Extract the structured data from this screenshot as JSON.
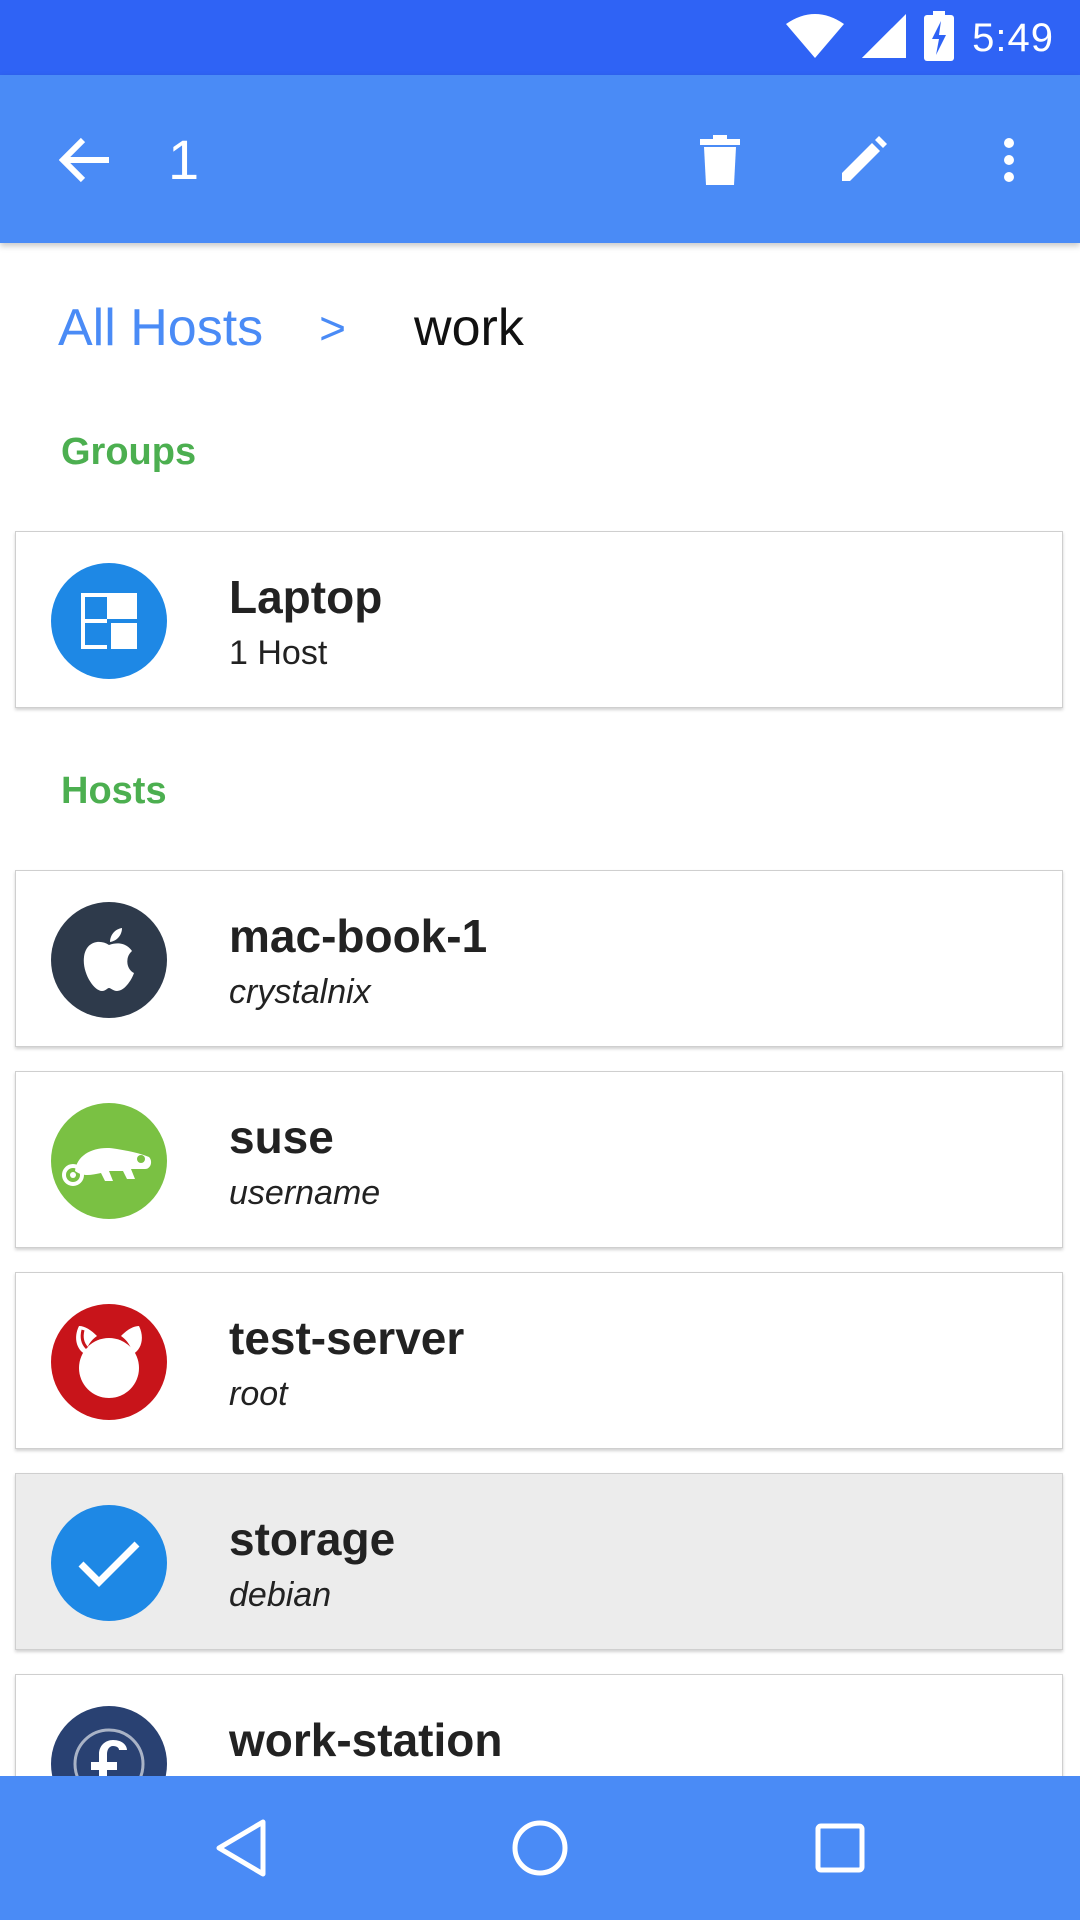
{
  "status_bar": {
    "time": "5:49",
    "icons": [
      "wifi-icon",
      "signal-icon",
      "battery-charging-icon"
    ]
  },
  "toolbar": {
    "selected_count": "1",
    "icons": [
      "back-arrow-icon",
      "delete-icon",
      "edit-icon",
      "more-vert-icon"
    ]
  },
  "breadcrumb": {
    "root": "All Hosts",
    "separator": ">",
    "current": "work"
  },
  "sections": {
    "groups_label": "Groups",
    "hosts_label": "Hosts"
  },
  "groups": [
    {
      "name": "Laptop",
      "subtitle": "1 Host",
      "icon": "group-icon",
      "color": "#1E88E5"
    }
  ],
  "hosts": [
    {
      "name": "mac-book-1",
      "user": "crystalnix",
      "icon": "apple-icon",
      "color": "#2E3A4B",
      "selected": false
    },
    {
      "name": "suse",
      "user": "username",
      "icon": "suse-icon",
      "color": "#7AC143",
      "selected": false
    },
    {
      "name": "test-server",
      "user": "root",
      "icon": "freebsd-icon",
      "color": "#C8141A",
      "selected": false
    },
    {
      "name": "storage",
      "user": "debian",
      "icon": "check-icon",
      "color": "#1E88E5",
      "selected": true
    },
    {
      "name": "work-station",
      "user": "",
      "icon": "fedora-icon",
      "color": "#294172",
      "selected": false
    }
  ],
  "colors": {
    "status_bar": "#2F63F5",
    "toolbar": "#4A8BF6",
    "accent_green": "#4CAF50"
  }
}
